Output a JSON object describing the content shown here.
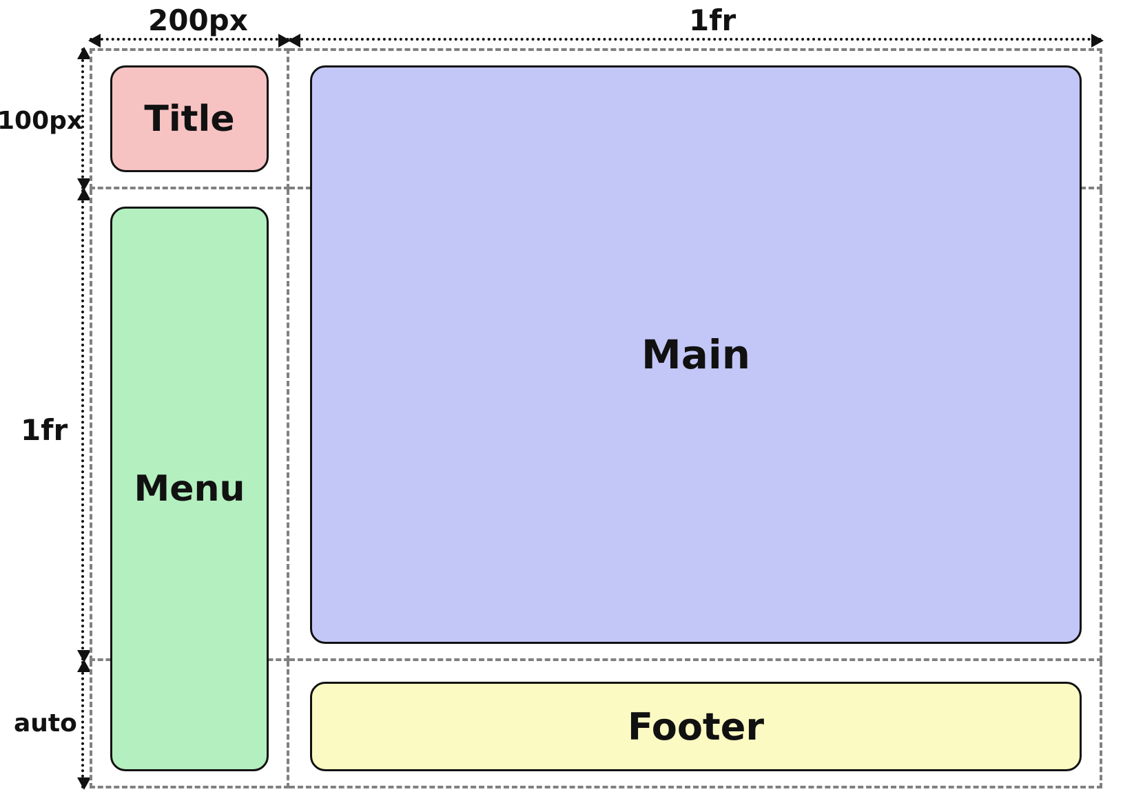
{
  "grid": {
    "columns": [
      {
        "size": "200px"
      },
      {
        "size": "1fr"
      }
    ],
    "rows": [
      {
        "size": "100px"
      },
      {
        "size": "1fr"
      },
      {
        "size": "auto"
      }
    ]
  },
  "regions": {
    "title": {
      "label": "Title",
      "color": "#f7c2c2"
    },
    "menu": {
      "label": "Menu",
      "color": "#b4efbf"
    },
    "main": {
      "label": "Main",
      "color": "#c3c7f7"
    },
    "footer": {
      "label": "Footer",
      "color": "#fcfac3"
    }
  }
}
